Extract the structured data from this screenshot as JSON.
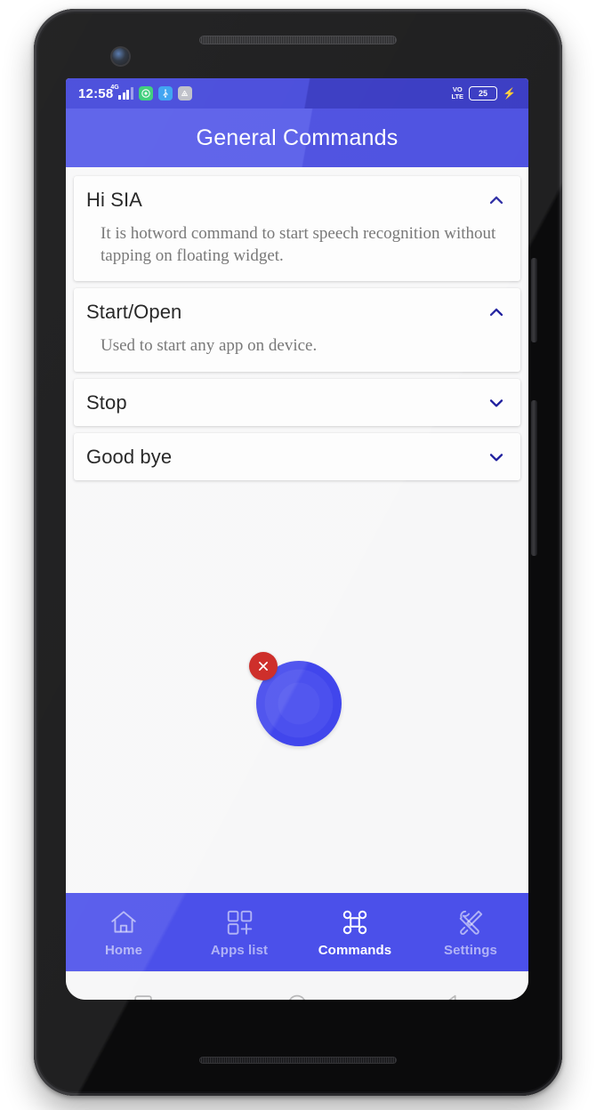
{
  "device": {
    "hardware": {
      "earpiece": "earpiece-speaker",
      "front_camera": "front-camera",
      "bottom_speaker": "bottom-speaker",
      "power_button": "power-button",
      "volume_button": "volume-rocker"
    }
  },
  "status_bar": {
    "time": "12:58",
    "network_type": "4G",
    "icons": [
      {
        "name": "signal-icon",
        "glyph": ""
      },
      {
        "name": "recorder-icon",
        "glyph": "◎"
      },
      {
        "name": "usb-icon",
        "glyph": "Ψ"
      },
      {
        "name": "app-icon",
        "glyph": "△"
      }
    ],
    "volte_line1": "VO",
    "volte_line2": "LTE",
    "battery_percent": "25",
    "charging_glyph": "⚡"
  },
  "app_bar": {
    "title": "General Commands",
    "bg_color": "#5055e8"
  },
  "commands": [
    {
      "title": "Hi SIA",
      "description": "It is hotword command to start speech recognition without tapping on floating widget.",
      "expanded": true,
      "chevron": "chevron-up-icon"
    },
    {
      "title": "Start/Open",
      "description": "Used to start any app on device.",
      "expanded": true,
      "chevron": "chevron-up-icon"
    },
    {
      "title": "Stop",
      "description": "",
      "expanded": false,
      "chevron": "chevron-down-icon"
    },
    {
      "title": "Good bye",
      "description": "",
      "expanded": false,
      "chevron": "chevron-down-icon"
    }
  ],
  "floating_widget": {
    "name": "floating-mic-widget",
    "bubble_color": "#4b50ee",
    "close_color": "#c91b17",
    "close_glyph": "×"
  },
  "bottom_nav": {
    "active": "Commands",
    "items": [
      {
        "label": "Home",
        "icon": "home-icon",
        "active": false
      },
      {
        "label": "Apps list",
        "icon": "apps-grid-plus-icon",
        "active": false
      },
      {
        "label": "Commands",
        "icon": "command-key-icon",
        "active": true
      },
      {
        "label": "Settings",
        "icon": "wrench-screwdriver-icon",
        "active": false
      }
    ]
  },
  "system_nav": {
    "items": [
      {
        "name": "recents-button",
        "shape": "square"
      },
      {
        "name": "home-button",
        "shape": "circle"
      },
      {
        "name": "back-button",
        "shape": "triangle"
      }
    ]
  },
  "colors": {
    "primary": "#5055e8",
    "status_bar": "#3b3fd8",
    "nav_bar": "#4b50ea",
    "chevron": "#1f1f9e",
    "content_bg": "#f7f7f8",
    "card_bg": "#fdfdfd"
  }
}
